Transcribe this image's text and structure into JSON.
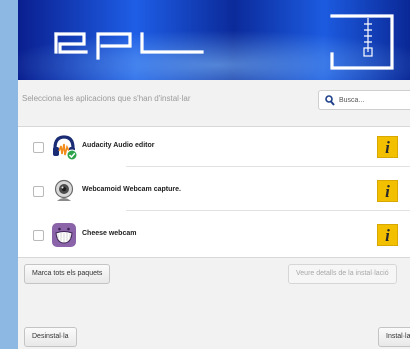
{
  "instruction": "Selecciona les aplicacions que s'han d'instal·lar",
  "search": {
    "placeholder": "Busca..."
  },
  "apps": [
    {
      "name": "Audacity Audio editor",
      "icon": "audacity-icon",
      "checked": false
    },
    {
      "name": "Webcamoid Webcam capture.",
      "icon": "webcamoid-icon",
      "checked": false
    },
    {
      "name": "Cheese webcam",
      "icon": "cheese-icon",
      "checked": false
    }
  ],
  "info_glyph": "i",
  "buttons": {
    "mark_all": "Marca tots els paquets",
    "details": "Veure detalls de la instal·lació",
    "uninstall": "Desinstal·la",
    "install": "Instal·la"
  },
  "colors": {
    "banner": "#1e5ee6",
    "info": "#f3c000",
    "desktop": "#8db8e3"
  }
}
